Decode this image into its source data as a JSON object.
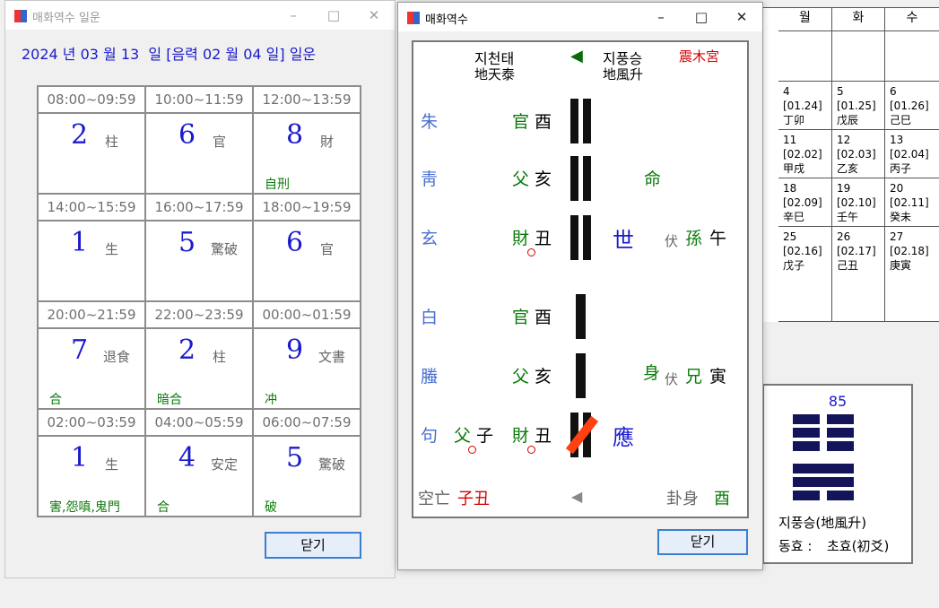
{
  "calendar": {
    "weekdays": [
      "월",
      "화",
      "수"
    ],
    "weeks": [
      [
        {
          "d": "4",
          "lunar": "[01.24]",
          "gz": "丁卯"
        },
        {
          "d": "5",
          "lunar": "[01.25]",
          "gz": "戊辰"
        },
        {
          "d": "6",
          "lunar": "[01.26]",
          "gz": "己巳"
        }
      ],
      [
        {
          "d": "11",
          "lunar": "[02.02]",
          "gz": "甲戌"
        },
        {
          "d": "12",
          "lunar": "[02.03]",
          "gz": "乙亥"
        },
        {
          "d": "13",
          "lunar": "[02.04]",
          "gz": "丙子"
        }
      ],
      [
        {
          "d": "18",
          "lunar": "[02.09]",
          "gz": "辛巳"
        },
        {
          "d": "19",
          "lunar": "[02.10]",
          "gz": "壬午"
        },
        {
          "d": "20",
          "lunar": "[02.11]",
          "gz": "癸未"
        }
      ],
      [
        {
          "d": "25",
          "lunar": "[02.16]",
          "gz": "戊子"
        },
        {
          "d": "26",
          "lunar": "[02.17]",
          "gz": "己丑"
        },
        {
          "d": "27",
          "lunar": "[02.18]",
          "gz": "庚寅"
        }
      ]
    ]
  },
  "result_panel": {
    "number": "85",
    "name": "지풍승(地風升)",
    "moving_label": "동효 :",
    "moving_value": "초효(初爻)"
  },
  "daily_window": {
    "title": "매화역수 일운",
    "date_line": "2024 년 03 월 13  일 [음력 02 월 04 일] 일운",
    "close_label": "닫기",
    "cells": [
      {
        "time": "08:00~09:59",
        "num": "2",
        "label": "柱",
        "note": ""
      },
      {
        "time": "10:00~11:59",
        "num": "6",
        "label": "官",
        "note": ""
      },
      {
        "time": "12:00~13:59",
        "num": "8",
        "label": "財",
        "note": "自刑"
      },
      {
        "time": "14:00~15:59",
        "num": "1",
        "label": "生",
        "note": ""
      },
      {
        "time": "16:00~17:59",
        "num": "5",
        "label": "驚破",
        "note": ""
      },
      {
        "time": "18:00~19:59",
        "num": "6",
        "label": "官",
        "note": ""
      },
      {
        "time": "20:00~21:59",
        "num": "7",
        "label": "退食",
        "note": "合"
      },
      {
        "time": "22:00~23:59",
        "num": "2",
        "label": "柱",
        "note": "暗合"
      },
      {
        "time": "00:00~01:59",
        "num": "9",
        "label": "文書",
        "note": "冲"
      },
      {
        "time": "02:00~03:59",
        "num": "1",
        "label": "生",
        "note": "害,怨嗔,鬼門"
      },
      {
        "time": "04:00~05:59",
        "num": "4",
        "label": "安定",
        "note": "合"
      },
      {
        "time": "06:00~07:59",
        "num": "5",
        "label": "驚破",
        "note": "破"
      }
    ]
  },
  "hexagram_window": {
    "title": "매화역수",
    "close_label": "닫기",
    "orig_name_kr": "지천태",
    "orig_name_cn": "地天泰",
    "arrow": "◀",
    "changed_name_kr": "지풍승",
    "changed_name_cn": "地風升",
    "palace": "震木宮",
    "lines": [
      {
        "animal": "朱",
        "relation": "官",
        "branch": "酉",
        "yin": true,
        "mark": "",
        "world": "",
        "fu": "",
        "hidden_rel": "",
        "hidden_branch": "",
        "hidden_right": "",
        "circle": false,
        "extra_rel": "",
        "extra_branch": "",
        "extra_circle": false
      },
      {
        "animal": "靑",
        "relation": "父",
        "branch": "亥",
        "yin": true,
        "mark": "",
        "world": "",
        "fu": "",
        "hidden_rel": "",
        "hidden_branch": "",
        "hidden_right": "命",
        "circle": false,
        "extra_rel": "",
        "extra_branch": "",
        "extra_circle": false
      },
      {
        "animal": "玄",
        "relation": "財",
        "branch": "丑",
        "yin": true,
        "mark": "",
        "world": "世",
        "fu": "伏",
        "hidden_rel": "孫",
        "hidden_branch": "午",
        "hidden_right": "",
        "circle": true,
        "extra_rel": "",
        "extra_branch": "",
        "extra_circle": false
      },
      {
        "animal": "白",
        "relation": "官",
        "branch": "酉",
        "yin": false,
        "mark": "",
        "world": "",
        "fu": "",
        "hidden_rel": "",
        "hidden_branch": "",
        "hidden_right": "",
        "circle": false,
        "extra_rel": "",
        "extra_branch": "",
        "extra_circle": false
      },
      {
        "animal": "螣",
        "relation": "父",
        "branch": "亥",
        "yin": false,
        "mark": "",
        "world": "",
        "fu": "伏",
        "hidden_rel": "兄",
        "hidden_branch": "寅",
        "hidden_right": "身",
        "circle": false,
        "extra_rel": "",
        "extra_branch": "",
        "extra_circle": false
      },
      {
        "animal": "句",
        "relation": "財",
        "branch": "丑",
        "yin": true,
        "mark": "moving",
        "world": "應",
        "fu": "",
        "hidden_rel": "",
        "hidden_branch": "",
        "hidden_right": "",
        "circle": true,
        "extra_rel": "父",
        "extra_branch": "子",
        "extra_circle": true
      }
    ],
    "void_label": "空亡",
    "void_value": "子丑",
    "bottom_arrow": "◀",
    "body_label": "卦身",
    "body_value": "酉"
  },
  "colors": {
    "blue": "#1a1acc",
    "green": "#0a7a0a",
    "red": "#d40000",
    "animal": "#4a6fd0",
    "moving": "#ff4010",
    "navy": "#14145a"
  }
}
